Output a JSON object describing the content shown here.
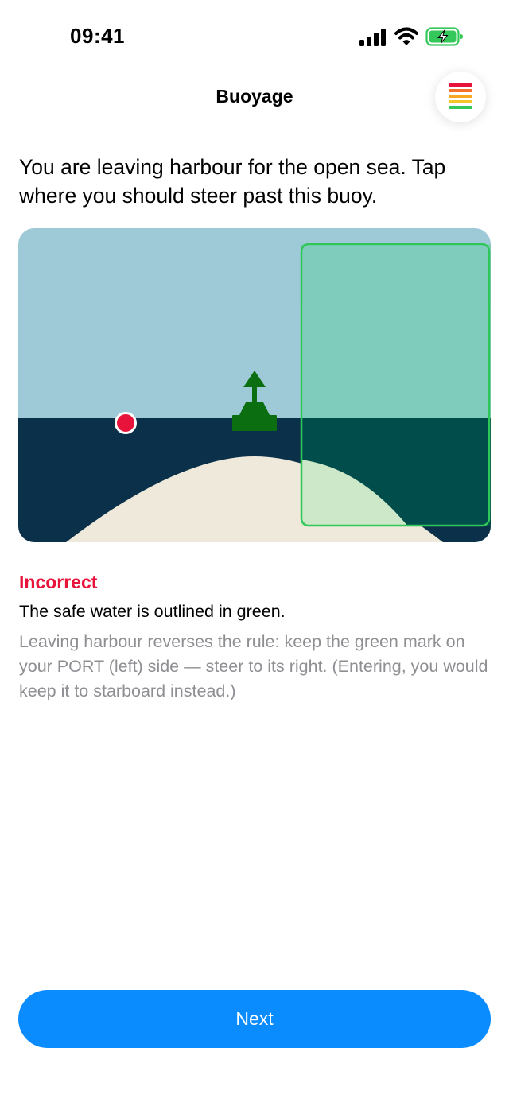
{
  "status_bar": {
    "time": "09:41",
    "icons": [
      "cellular-signal-icon",
      "wifi-icon",
      "battery-charging-icon"
    ]
  },
  "nav": {
    "title": "Buoyage",
    "menu_icon": "progress-levels-icon"
  },
  "question": {
    "text": "You are leaving harbour for the open sea. Tap where you should steer past this buoy."
  },
  "scene": {
    "buoy": "green-starboard-buoy",
    "tap_marker": "red-dot",
    "safe_zone": "right-of-buoy",
    "colors": {
      "sky": "#9ec9d7",
      "sea": "#0a3149",
      "sand": "#efe9dc",
      "buoy": "#0b6e10",
      "tap_marker": "#e8133a",
      "safe_outline": "#30c759"
    }
  },
  "result": {
    "label": "Incorrect",
    "label_color": "#e8133a",
    "subtitle": "The safe water is outlined in green.",
    "explanation": "Leaving harbour reverses the rule: keep the green mark on your PORT (left) side — steer to its right. (Entering, you would keep it to starboard instead.)"
  },
  "actions": {
    "next_label": "Next",
    "next_color": "#0a8cff"
  }
}
